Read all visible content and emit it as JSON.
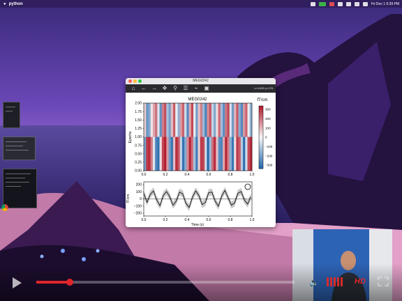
{
  "menubar": {
    "app_name": "python",
    "clock": "Fri Dec 1 6:39 PM"
  },
  "window": {
    "title": "MEG0242",
    "toolbar_icons": [
      "home-icon",
      "back-icon",
      "forward-icon",
      "pan-icon",
      "zoom-icon",
      "subplots-icon",
      "edit-axes-icon",
      "save-icon"
    ],
    "cursor_readout": "x=0.853 y=178."
  },
  "figure": {
    "title": "MEG0242",
    "image_ylabel": "Epochs",
    "cbar_label": "fT/cm",
    "cbar_ticks": [
      "300",
      "200",
      "100",
      "0",
      "−100",
      "−200",
      "−300"
    ],
    "image_yticks": [
      "2.00",
      "1.75",
      "1.50",
      "1.25",
      "1.00",
      "0.75",
      "0.50",
      "0.25",
      "0.00"
    ],
    "xticks": [
      "0.0",
      "0.2",
      "0.4",
      "0.6",
      "0.8",
      "1.0"
    ],
    "evoked_yticks": [
      "200",
      "100",
      "0",
      "−100",
      "−200"
    ],
    "evoked_ylabel": "fT/cm",
    "evoked_xlabel": "Time (s)"
  },
  "chart_data": [
    {
      "type": "heatmap",
      "title": "MEG0242",
      "ylabel": "Epochs",
      "colorbar_label": "fT/cm",
      "colorbar_range": [
        -330,
        330
      ],
      "x_range": [
        0.0,
        1.0
      ],
      "y_range": [
        0.0,
        2.0
      ],
      "rows": [
        [
          60,
          -220,
          -180,
          30,
          120,
          200,
          -40,
          -230,
          180,
          250,
          -120,
          -200,
          90,
          230,
          -20,
          -160,
          140,
          220,
          -60,
          -250,
          120,
          260,
          -30,
          -200,
          80,
          180,
          -140,
          -260,
          160,
          240,
          -80,
          -180,
          40,
          210,
          -130,
          -240,
          190,
          260,
          -50,
          -210,
          100,
          230,
          -170,
          -250,
          140,
          220,
          -20,
          -160
        ],
        [
          -200,
          280,
          300,
          180,
          -40,
          -260,
          -300,
          40,
          260,
          320,
          140,
          -210,
          -290,
          90,
          300,
          240,
          -80,
          -300,
          -180,
          160,
          310,
          200,
          -120,
          -280,
          60,
          280,
          260,
          -60,
          -320,
          -140,
          200,
          300,
          80,
          -240,
          -260,
          120,
          310,
          180,
          -160,
          -290,
          40,
          280,
          230,
          -100,
          -310,
          -60,
          250,
          300
        ]
      ]
    },
    {
      "type": "line",
      "xlabel": "Time (s)",
      "ylabel": "fT/cm",
      "xlim": [
        0.0,
        1.0
      ],
      "ylim": [
        -300,
        300
      ],
      "series": [
        {
          "x": [
            0.0,
            0.03,
            0.06,
            0.09,
            0.12,
            0.15,
            0.18,
            0.21,
            0.24,
            0.27,
            0.3,
            0.33,
            0.36,
            0.39,
            0.42,
            0.45,
            0.48,
            0.51,
            0.54,
            0.57,
            0.6,
            0.63,
            0.66,
            0.69,
            0.72,
            0.75,
            0.78,
            0.81,
            0.84,
            0.87,
            0.9,
            0.93,
            0.96,
            0.99
          ],
          "values": [
            100,
            -60,
            80,
            140,
            -20,
            -120,
            60,
            130,
            40,
            -110,
            -40,
            120,
            90,
            -80,
            -150,
            30,
            140,
            60,
            -100,
            -60,
            110,
            120,
            -40,
            -130,
            50,
            150,
            20,
            -110,
            -70,
            100,
            130,
            -20,
            -90,
            40
          ]
        }
      ]
    }
  ],
  "video": {
    "progress": 0.13,
    "volume_bars": 5,
    "hd_label": "HD"
  },
  "colors": {
    "accent": "#e0252a",
    "figure_toolbar": "#2b2b2f"
  }
}
